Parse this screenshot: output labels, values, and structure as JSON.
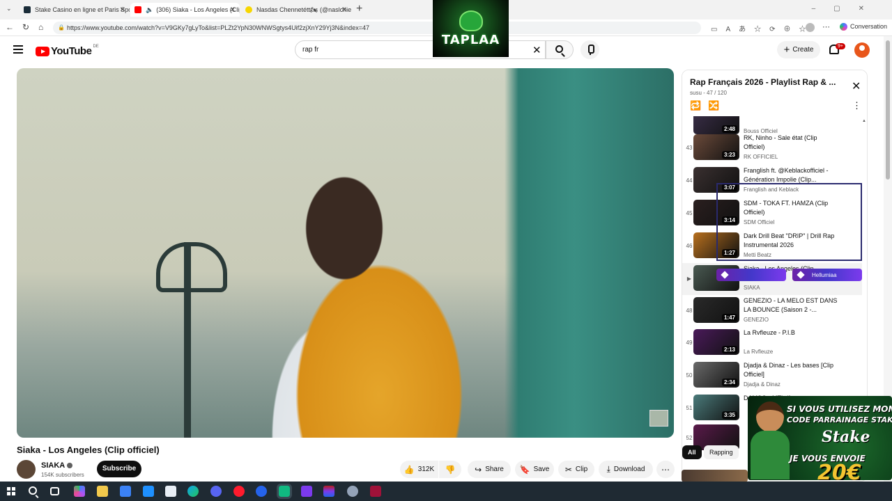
{
  "browser": {
    "tabs": [
      {
        "title": "Stake Casino en ligne et Paris Spo",
        "favicon_color": "#1a2c38",
        "active": false
      },
      {
        "title": "(306) Siaka - Los Angeles (Clip",
        "favicon_color": "#ff0000",
        "active": true
      },
      {
        "title": "Nasdas Chennetétt🏍 (@naslchier",
        "favicon_color": "#f7d600",
        "active": false
      }
    ],
    "url": "https://www.youtube.com/watch?v=V9GKy7gLyTo&list=PLZt2YpN30WNWSgtys4Uif2zjXnY29Yj3N&index=47",
    "copilot_label": "Conversation"
  },
  "stream_logo": {
    "text": "TAPLAA"
  },
  "youtube": {
    "logo_word": "YouTube",
    "country": "DE",
    "search_value": "rap fr",
    "create_label": "Create",
    "notif_count": "9+"
  },
  "video": {
    "title": "Siaka - Los Angeles (Clip officiel)",
    "channel": "SIAKA",
    "subscribers": "154K subscribers",
    "subscribe_label": "Subscribe",
    "actions": {
      "likes": "312K",
      "share": "Share",
      "save": "Save",
      "clip": "Clip",
      "download": "Download"
    }
  },
  "playlist": {
    "title": "Rap Français 2026 - Playlist Rap & ...",
    "subtitle": "susu - 47 / 120",
    "items": [
      {
        "index": "",
        "title": "",
        "channel": "Bouss Officiel",
        "duration": "2:48",
        "thumb": "#3b2f4a"
      },
      {
        "index": "43",
        "title": "RK, Ninho - Sale état (Clip Officiel)",
        "channel": "RK OFFICIEL",
        "duration": "3:23",
        "thumb": "#6b4a3a"
      },
      {
        "index": "44",
        "title": "Franglish ft. @Keblackofficiel - Génération Impolie (Clip...",
        "channel": "Franglish and Keblack",
        "duration": "3:07",
        "thumb": "#3a3030"
      },
      {
        "index": "45",
        "title": "SDM - TOKA FT. HAMZA (Clip Officiel)",
        "channel": "SDM Officiel",
        "duration": "3:14",
        "thumb": "#2a1f1f"
      },
      {
        "index": "46",
        "title": "Dark Drill Beat \"DRIP\" | Drill Rap Instrumental 2026",
        "channel": "Metti Beatz",
        "duration": "1:27",
        "thumb": "#b8701e"
      },
      {
        "index": "▶",
        "title": "Siaka - Los Angeles (Clip",
        "channel": "SIAKA",
        "duration": "",
        "thumb": "#4a5a52"
      },
      {
        "index": "48",
        "title": "GENEZIO - LA MELO EST DANS LA BOUNCE (Saison 2 -...",
        "channel": "GENEZIO",
        "duration": "1:47",
        "thumb": "#2a2a2a"
      },
      {
        "index": "49",
        "title": "La Rvfleuze - P.I.B",
        "channel": "La Rvfleuze",
        "duration": "2:13",
        "thumb": "#4a1a5a"
      },
      {
        "index": "50",
        "title": "Djadja & Dinaz - Les bases [Clip Officiel]",
        "channel": "Djadja & Dinaz",
        "duration": "2:34",
        "thumb": "#6a6a6a"
      },
      {
        "index": "51",
        "title": "DAMSO - MTL (feat.",
        "channel": "",
        "duration": "3:35",
        "thumb": "#4a7a7a"
      },
      {
        "index": "52",
        "title": "",
        "channel": "",
        "duration": "",
        "thumb": "#5a1a4a"
      }
    ]
  },
  "overlay": {
    "badge_right": "Hellumiaa"
  },
  "chips": [
    "All",
    "Rapping"
  ],
  "promo": {
    "line1": "SI VOUS UTILISEZ MON",
    "line2": "CODE PARRAINAGE STAKE",
    "brand": "Stake",
    "line3": "JE VOUS ENVOIE",
    "amount": "20€"
  }
}
